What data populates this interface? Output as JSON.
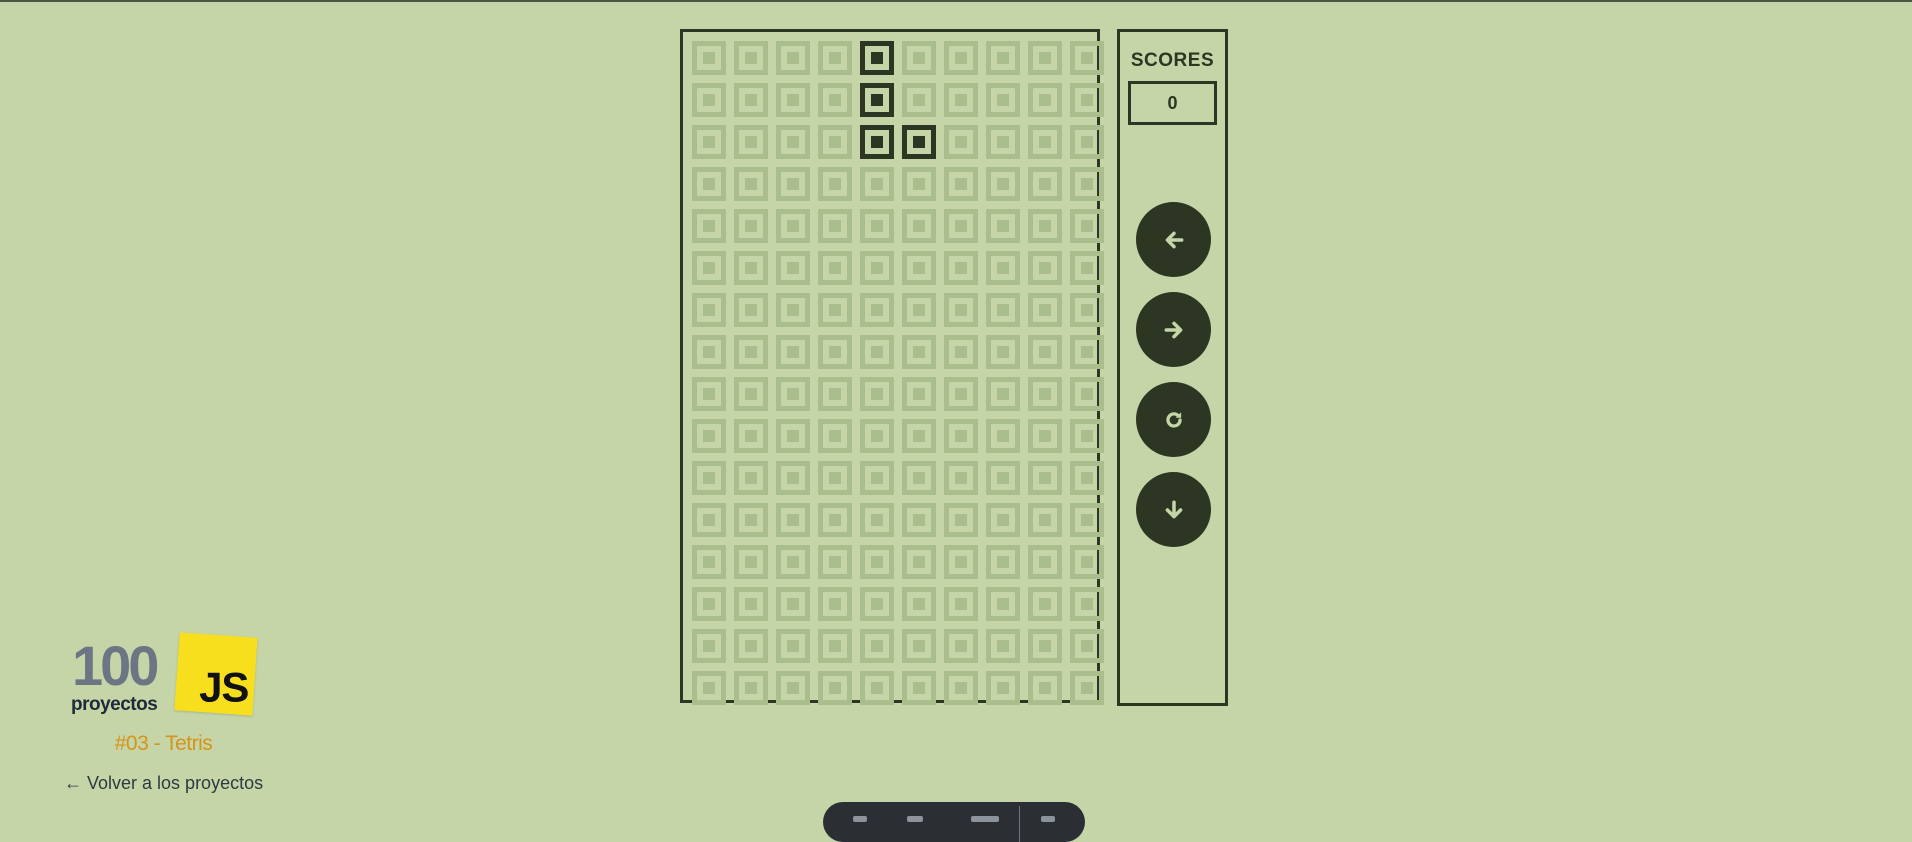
{
  "game": {
    "columns": 10,
    "rows": 16,
    "active_cells": [
      [
        0,
        4
      ],
      [
        1,
        4
      ],
      [
        2,
        4
      ],
      [
        2,
        5
      ]
    ]
  },
  "scores": {
    "title": "SCORES",
    "value": "0"
  },
  "controls": [
    {
      "name": "move-left-button",
      "icon": "arrow-left-icon"
    },
    {
      "name": "move-right-button",
      "icon": "arrow-right-icon"
    },
    {
      "name": "rotate-button",
      "icon": "rotate-icon"
    },
    {
      "name": "move-down-button",
      "icon": "arrow-down-icon"
    }
  ],
  "branding": {
    "number": "100",
    "word": "proyectos",
    "js": "JS",
    "project_title": "#03 - Tetris",
    "back_link": "← Volver a los proyectos"
  },
  "colors": {
    "background": "#c5d5a8",
    "dark": "#2d3622",
    "cell_inactive": "#a9bd8d",
    "js_yellow": "#f7df1e",
    "title_orange": "#d4951a"
  }
}
